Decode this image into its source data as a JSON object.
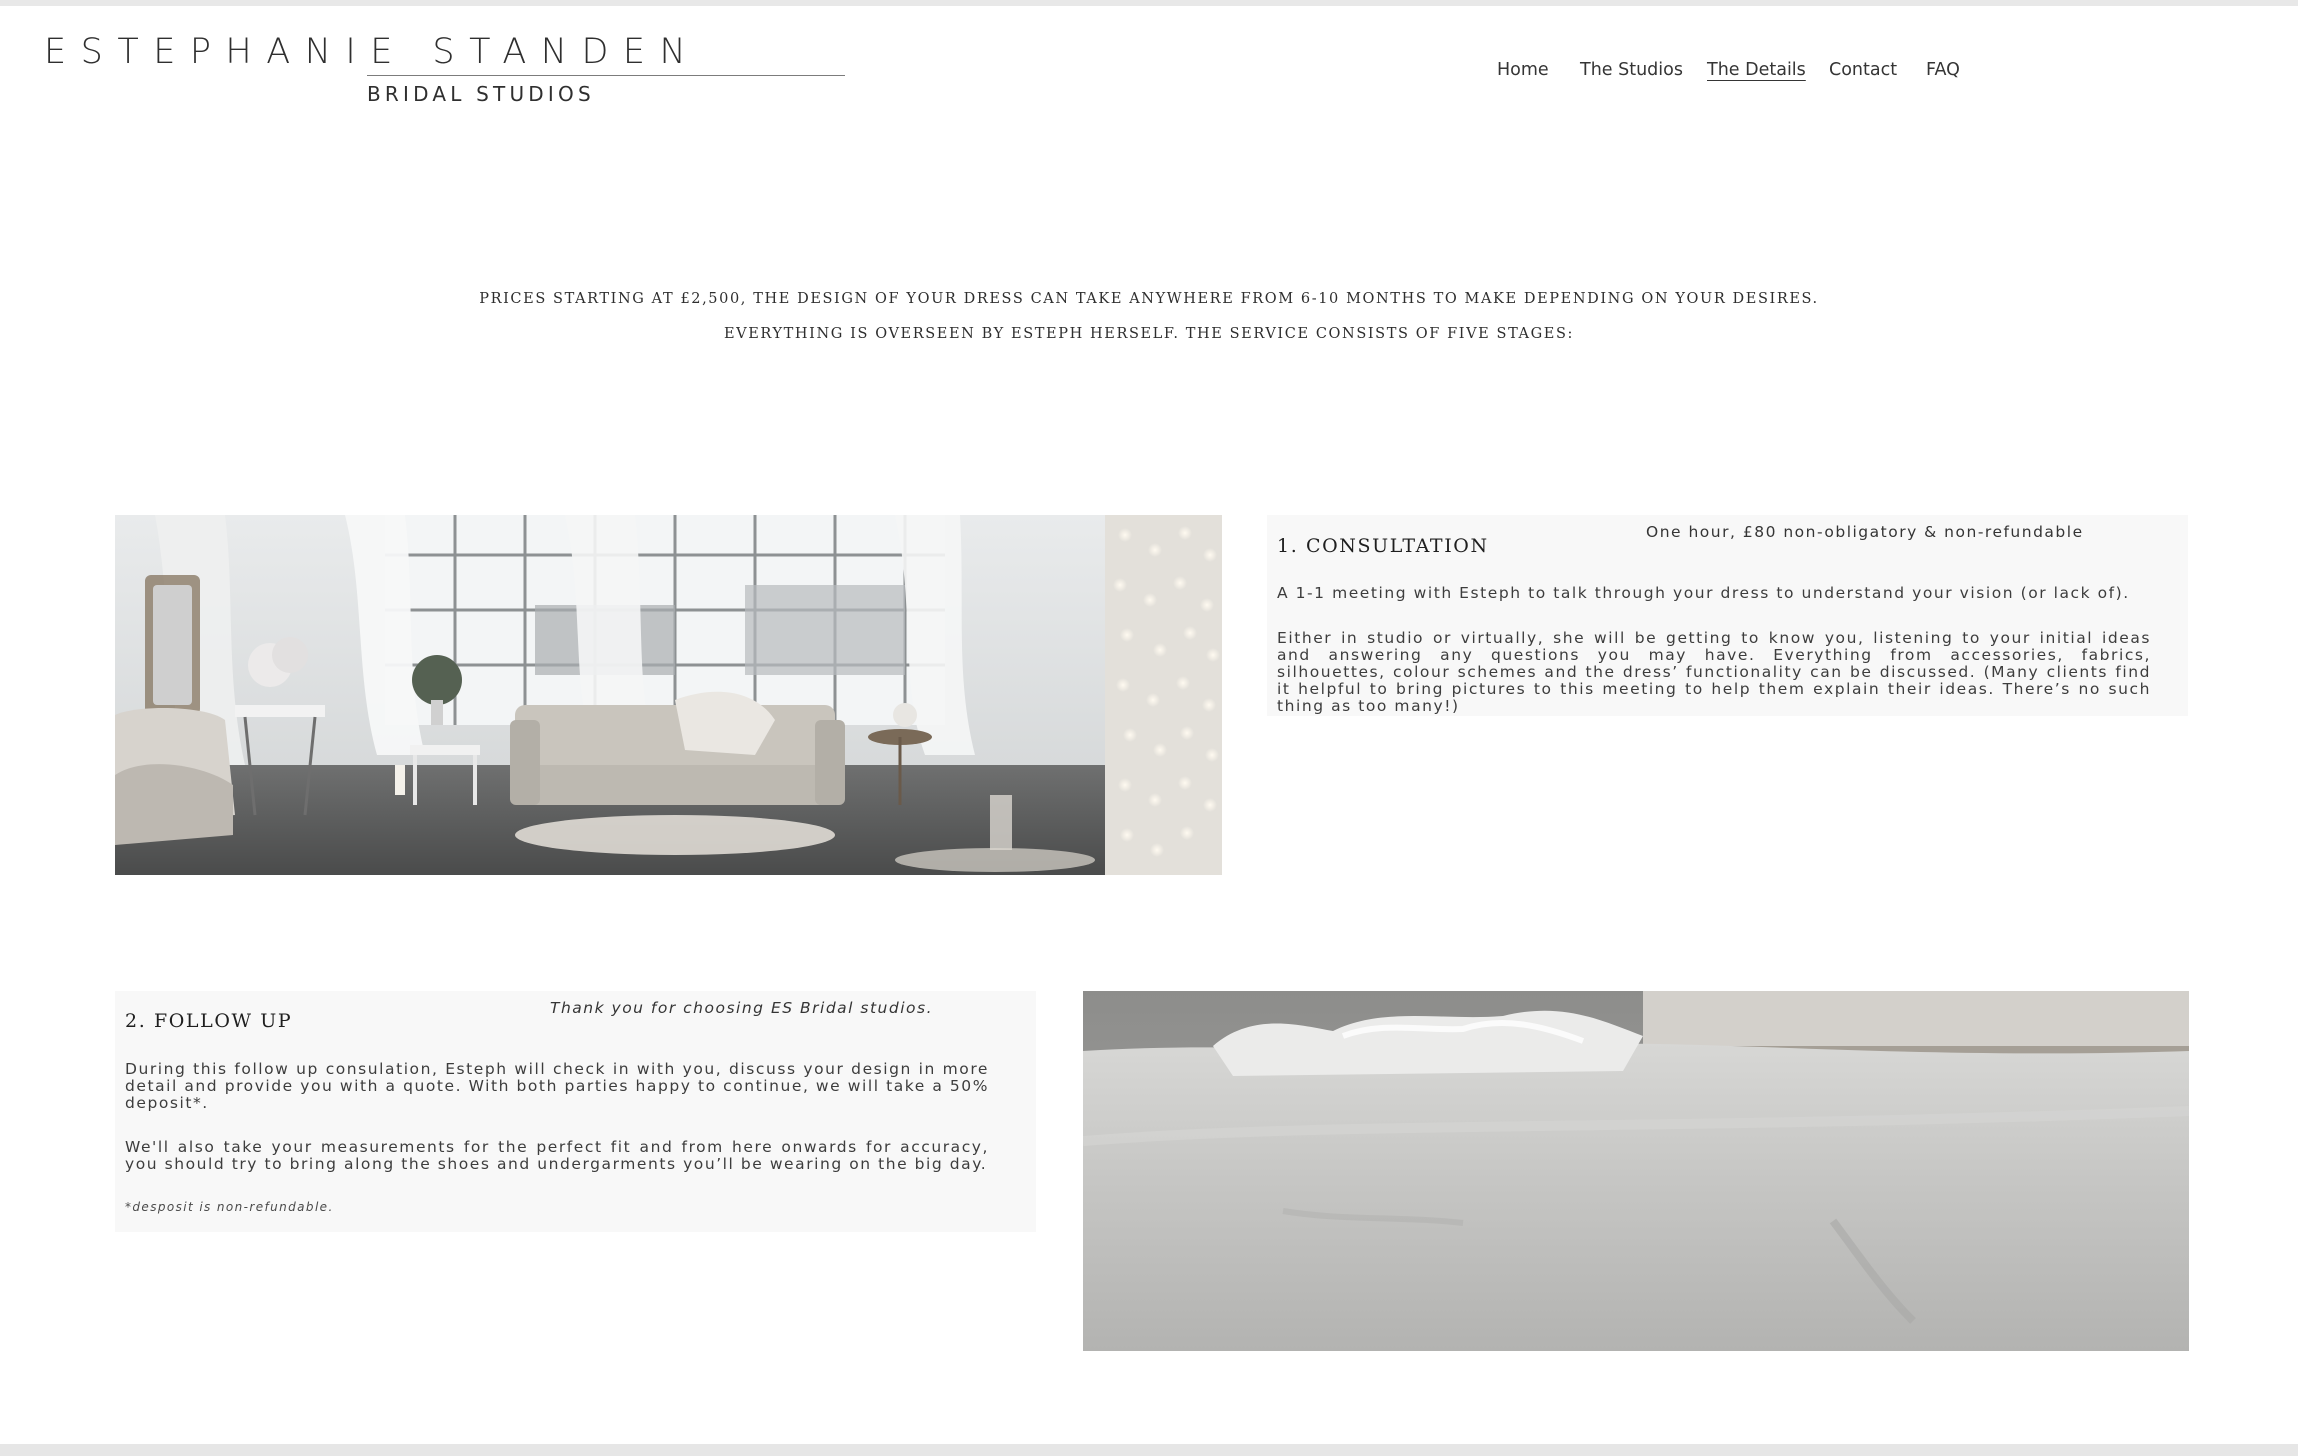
{
  "brand": {
    "name": "ESTEPHANIE STANDEN",
    "tagline": "BRIDAL STUDIOS"
  },
  "nav": {
    "items": [
      {
        "label": "Home"
      },
      {
        "label": "The Studios"
      },
      {
        "label": "The Details"
      },
      {
        "label": "Contact"
      },
      {
        "label": "FAQ"
      }
    ],
    "active": "The Details"
  },
  "intro": {
    "line1": "PRICES STARTING AT £2,500, THE DESIGN OF YOUR DRESS CAN TAKE ANYWHERE FROM 6-10 MONTHS TO MAKE DEPENDING ON YOUR DESIRES.",
    "line2": "EVERYTHING IS OVERSEEN BY ESTEPH HERSELF. THE SERVICE CONSISTS OF FIVE STAGES:"
  },
  "stages": [
    {
      "title": "1. CONSULTATION",
      "aside": "One hour, £80 non-obligatory & non-refundable",
      "paragraphs": [
        "A 1-1 meeting with Esteph to talk through your dress to understand your vision (or lack of).",
        "Either in studio or virtually, she will be getting to know you, listening to your initial ideas and answering any questions you may have. Everything from accessories, fabrics, silhouettes, colour schemes and the dress’ functionality can be discussed. (Many clients find it helpful to bring pictures to this meeting to help them explain their ideas. There’s no such thing as too many!)"
      ]
    },
    {
      "title": "2. FOLLOW UP",
      "aside": "Thank you for choosing ES Bridal studios.",
      "paragraphs": [
        "During this follow up consulation, Esteph will check in with you, discuss your design in more detail and provide you with a quote. With both parties happy to continue, we will take a 50% deposit*.",
        "We'll also take your measurements for the perfect fit and from here onwards for accuracy, you should try to bring along the shoes and undergarments you’ll be wearing on the big day."
      ],
      "note": "*desposit is non-refundable."
    }
  ],
  "colors": {
    "text": "#3a3a3a",
    "panel_bg": "#f8f8f8",
    "rule": "#e6e6e6"
  }
}
